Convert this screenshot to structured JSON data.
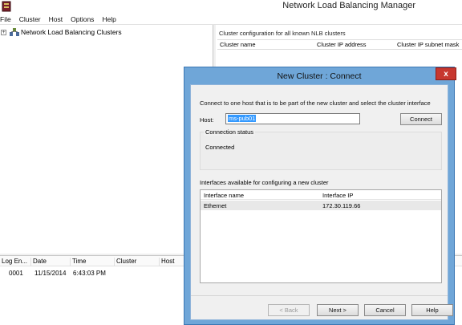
{
  "window": {
    "title": "Network Load Balancing Manager"
  },
  "menu": [
    "File",
    "Cluster",
    "Host",
    "Options",
    "Help"
  ],
  "tree": {
    "expander": "+",
    "root_label": "Network Load Balancing Clusters"
  },
  "right_pane": {
    "caption": "Cluster configuration for all known NLB clusters",
    "columns": [
      "Cluster name",
      "Cluster IP address",
      "Cluster IP subnet mask"
    ]
  },
  "log": {
    "columns": [
      "Log En...",
      "Date",
      "Time",
      "Cluster",
      "Host"
    ],
    "rows": [
      {
        "entry": "0001",
        "date": "11/15/2014",
        "time": "6:43:03 PM",
        "cluster": "",
        "host": ""
      }
    ]
  },
  "dialog": {
    "title": "New Cluster : Connect",
    "close_glyph": "x",
    "instruction": "Connect to one host that is to be part of the new cluster and select the cluster interface",
    "host_label": "Host:",
    "host_value": "ms-pub01",
    "connect_button": "Connect",
    "status_group_label": "Connection status",
    "status_text": "Connected",
    "interfaces_label": "Interfaces available for configuring a new cluster",
    "interface_columns": [
      "Interface name",
      "Interface IP"
    ],
    "interfaces": [
      {
        "name": "Ethernet",
        "ip": "172.30.119.66"
      }
    ],
    "buttons": {
      "back": "< Back",
      "next": "Next >",
      "cancel": "Cancel",
      "help": "Help"
    }
  },
  "colors": {
    "dialog_frame": "#6fa6d8",
    "close_button": "#c7372f",
    "selection": "#3399ff"
  },
  "icons": {
    "app": "nlb-manager-icon",
    "tree": "cluster-icon"
  }
}
